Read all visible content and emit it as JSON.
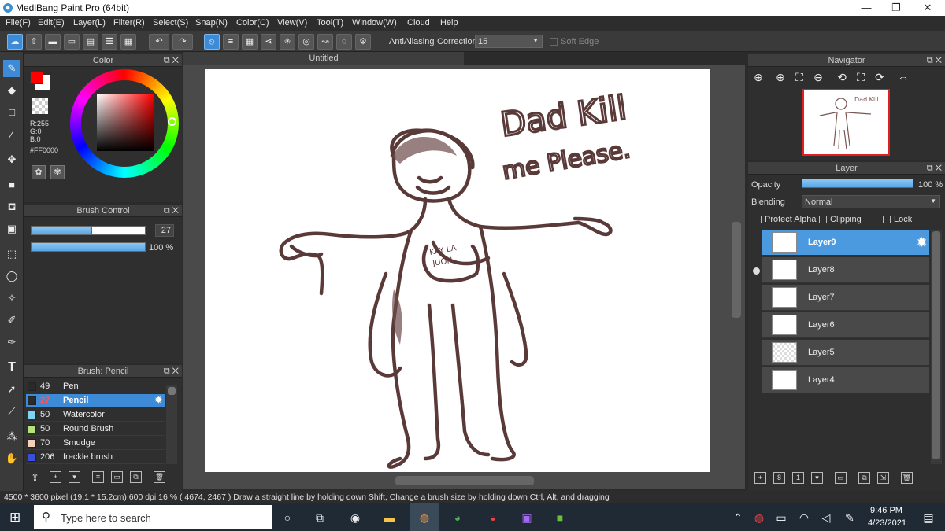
{
  "window": {
    "title": "MediBang Paint Pro (64bit)",
    "minimize": "—",
    "maximize": "❐",
    "close": "✕"
  },
  "menu": [
    "File(F)",
    "Edit(E)",
    "Layer(L)",
    "Filter(R)",
    "Select(S)",
    "Snap(N)",
    "Color(C)",
    "View(V)",
    "Tool(T)",
    "Window(W)",
    "Cloud",
    "Help"
  ],
  "toolbar": {
    "antialiasing": "AntiAliasing",
    "correction_label": "Correction",
    "correction_value": "15",
    "soft_edge": "Soft Edge"
  },
  "color_panel": {
    "title": "Color",
    "r": "R:255",
    "g": "G:0",
    "b": "B:0",
    "hex": "#FF0000",
    "primary": "#ff0000"
  },
  "brush_control": {
    "title": "Brush Control",
    "size": "27",
    "opacity": "100 %"
  },
  "brush_list": {
    "title": "Brush: Pencil",
    "items": [
      {
        "size": "49",
        "name": "Pen",
        "color": "#2a2a2a"
      },
      {
        "size": "27",
        "name": "Pencil",
        "color": "#2a2a2a",
        "selected": true
      },
      {
        "size": "50",
        "name": "Watercolor",
        "color": "#7fd4f4"
      },
      {
        "size": "50",
        "name": "Round Brush",
        "color": "#b6e27a"
      },
      {
        "size": "70",
        "name": "Smudge",
        "color": "#f4d2b8"
      },
      {
        "size": "206",
        "name": "freckle brush",
        "color": "#3a4fd6"
      }
    ]
  },
  "document": {
    "tab": "Untitled",
    "drawing_text": "Dad Kill me Please.",
    "shirt_text": "KAY LA JUON"
  },
  "navigator": {
    "title": "Navigator"
  },
  "layer_panel": {
    "title": "Layer",
    "opacity_label": "Opacity",
    "opacity_value": "100 %",
    "blending_label": "Blending",
    "blending_value": "Normal",
    "protect_alpha": "Protect Alpha",
    "clipping": "Clipping",
    "lock": "Lock",
    "layers": [
      {
        "name": "Layer9",
        "selected": true
      },
      {
        "name": "Layer8",
        "visible_dot": true
      },
      {
        "name": "Layer7"
      },
      {
        "name": "Layer6"
      },
      {
        "name": "Layer5"
      },
      {
        "name": "Layer4"
      }
    ]
  },
  "status": {
    "text": "4500 * 3600 pixel   (19.1 * 15.2cm)   600 dpi   16 %   ( 4674, 2467 )   Draw a straight line by holding down Shift, Change a brush size by holding down Ctrl, Alt, and dragging"
  },
  "taskbar": {
    "search_placeholder": "Type here to search",
    "time": "9:46 PM",
    "date": "4/23/2021"
  }
}
